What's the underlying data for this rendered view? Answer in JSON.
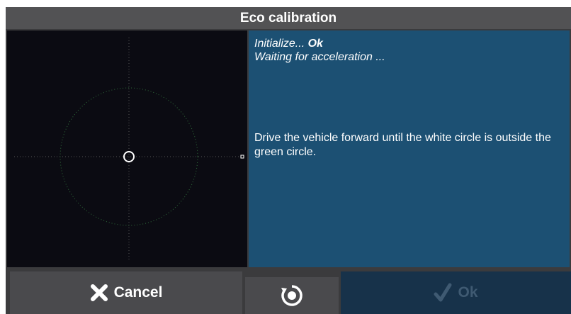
{
  "dialog": {
    "title": "Eco calibration"
  },
  "info": {
    "line1_prefix": "Initialize... ",
    "line1_status": "Ok",
    "line2": "Waiting for acceleration ...",
    "instruction": "Drive the vehicle forward until the white circle is outside the green circle."
  },
  "buttons": {
    "cancel_label": "Cancel",
    "ok_label": "Ok"
  },
  "icons": {
    "cancel": "close-x-icon",
    "reset": "reset-circle-icon",
    "ok": "checkmark-icon"
  },
  "colors": {
    "title_bar": "#525254",
    "dialog_bg": "#3b3b3d",
    "info_panel": "#1c5073",
    "target_circle": "#2f6b3a",
    "ok_disabled": "#17324a"
  }
}
